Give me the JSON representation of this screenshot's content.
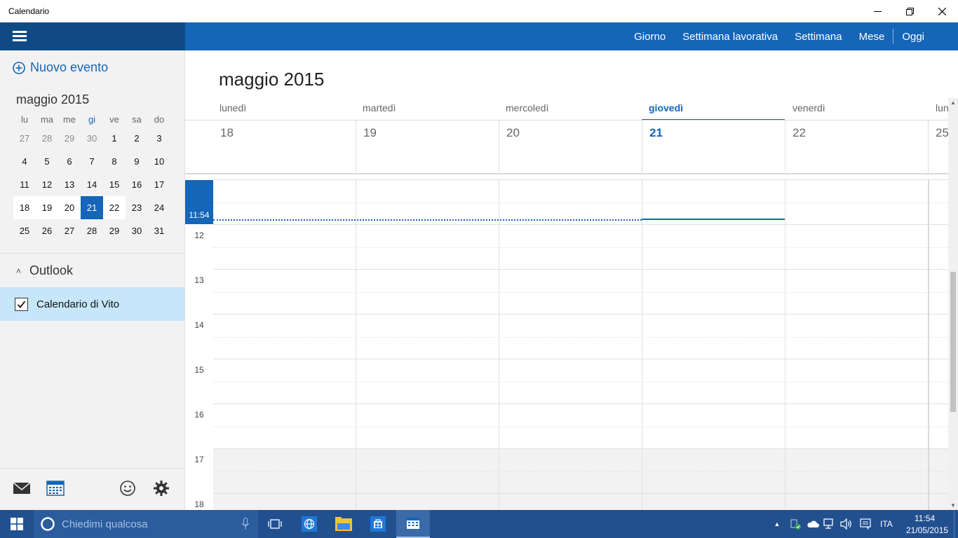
{
  "window": {
    "title": "Calendario"
  },
  "views": [
    "Giorno",
    "Settimana lavorativa",
    "Settimana",
    "Mese",
    "Oggi"
  ],
  "sidebar": {
    "new_event": "Nuovo evento",
    "mini_title": "maggio 2015",
    "weekday_heads": [
      "lu",
      "ma",
      "me",
      "gi",
      "ve",
      "sa",
      "do"
    ],
    "weeks": [
      [
        "27",
        "28",
        "29",
        "30",
        "1",
        "2",
        "3"
      ],
      [
        "4",
        "5",
        "6",
        "7",
        "8",
        "9",
        "10"
      ],
      [
        "11",
        "12",
        "13",
        "14",
        "15",
        "16",
        "17"
      ],
      [
        "18",
        "19",
        "20",
        "21",
        "22",
        "23",
        "24"
      ],
      [
        "25",
        "26",
        "27",
        "28",
        "29",
        "30",
        "31"
      ]
    ],
    "account": "Outlook",
    "calendar_name": "Calendario di Vito"
  },
  "main": {
    "month_title": "maggio 2015",
    "day_names": [
      "lunedì",
      "martedì",
      "mercoledì",
      "giovedì",
      "venerdì",
      "lun"
    ],
    "dates": [
      "18",
      "19",
      "20",
      "21",
      "22",
      "25"
    ],
    "current_time": "11:54",
    "hours": [
      "12",
      "13",
      "14",
      "15",
      "16",
      "17",
      "18"
    ]
  },
  "taskbar": {
    "search_placeholder": "Chiedimi qualcosa",
    "language": "ITA",
    "time": "11:54",
    "date": "21/05/2015"
  },
  "colors": {
    "accent": "#1565b8",
    "dark_accent": "#0f4a84",
    "selected_item": "#c6e7f9"
  }
}
